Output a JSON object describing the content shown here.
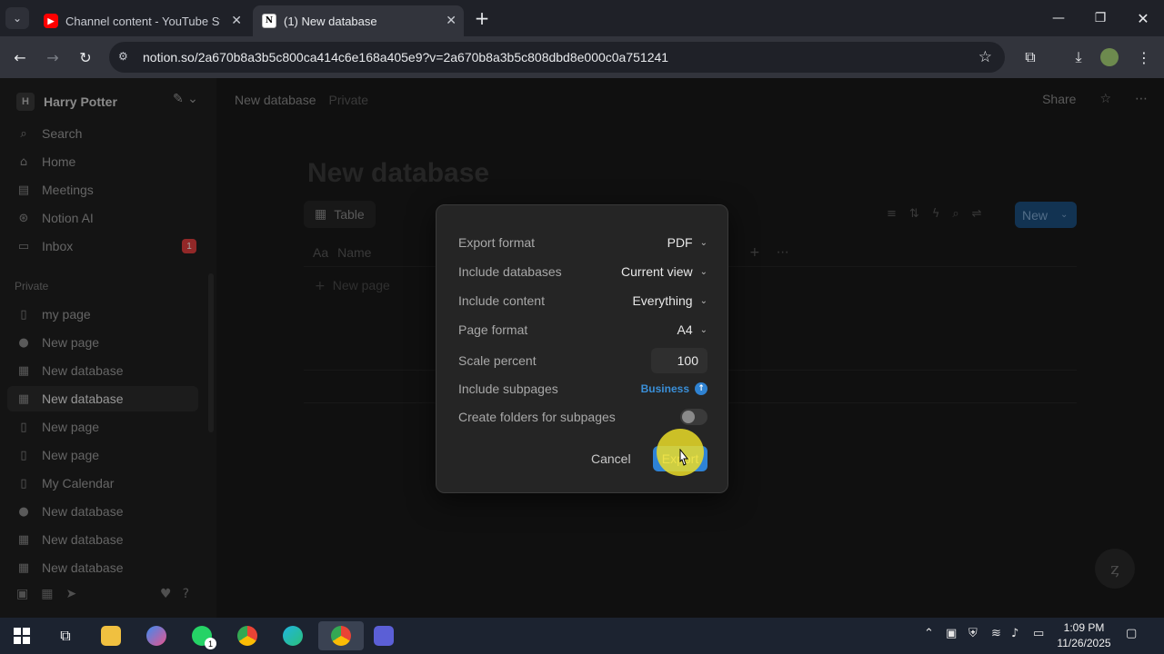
{
  "browser": {
    "tabs": [
      {
        "title": "Channel content - YouTube Stu",
        "favicon": "youtube-icon",
        "active": false
      },
      {
        "title": "(1) New database",
        "favicon": "notion-icon",
        "active": true
      }
    ],
    "url": "notion.so/2a670b8a3b5c800ca414c6e168a405e9?v=2a670b8a3b5c808dbd8e000c0a751241"
  },
  "sidebar": {
    "workspace_initial": "H",
    "workspace_name": "Harry Potter",
    "nav": [
      {
        "label": "Search",
        "icon": "search-icon"
      },
      {
        "label": "Home",
        "icon": "home-icon"
      },
      {
        "label": "Meetings",
        "icon": "meetings-icon"
      },
      {
        "label": "Notion AI",
        "icon": "notion-ai-icon"
      },
      {
        "label": "Inbox",
        "icon": "inbox-icon",
        "badge": "1"
      }
    ],
    "section_label": "Private",
    "pages": [
      {
        "label": "my page",
        "icon": "page-icon"
      },
      {
        "label": "New page",
        "icon": "alien-icon"
      },
      {
        "label": "New database",
        "icon": "table-icon"
      },
      {
        "label": "New database",
        "icon": "table-icon",
        "selected": true
      },
      {
        "label": "New page",
        "icon": "page-icon"
      },
      {
        "label": "New page",
        "icon": "page-icon"
      },
      {
        "label": "My Calendar",
        "icon": "page-icon"
      },
      {
        "label": "New database",
        "icon": "alien-icon"
      },
      {
        "label": "New database",
        "icon": "table-icon"
      },
      {
        "label": "New database",
        "icon": "table-icon"
      }
    ]
  },
  "topbar": {
    "breadcrumb": "New database",
    "privacy": "Private",
    "share": "Share"
  },
  "database": {
    "title": "New database",
    "view_tab": "Table",
    "new_button": "New",
    "name_column": "Name",
    "name_column_prefix": "Aa",
    "new_page_row": "New page"
  },
  "export_dialog": {
    "rows": [
      {
        "label": "Export format",
        "value": "PDF"
      },
      {
        "label": "Include databases",
        "value": "Current view"
      },
      {
        "label": "Include content",
        "value": "Everything"
      },
      {
        "label": "Page format",
        "value": "A4"
      }
    ],
    "scale_label": "Scale percent",
    "scale_value": "100",
    "subpages_label": "Include subpages",
    "subpages_badge": "Business",
    "folders_label": "Create folders for subpages",
    "folders_toggle_on": false,
    "cancel_label": "Cancel",
    "export_label": "Export",
    "accent": "#2e83d6"
  },
  "taskbar": {
    "time": "1:09 PM",
    "date": "11/26/2025",
    "whatsapp_badge": "1"
  }
}
